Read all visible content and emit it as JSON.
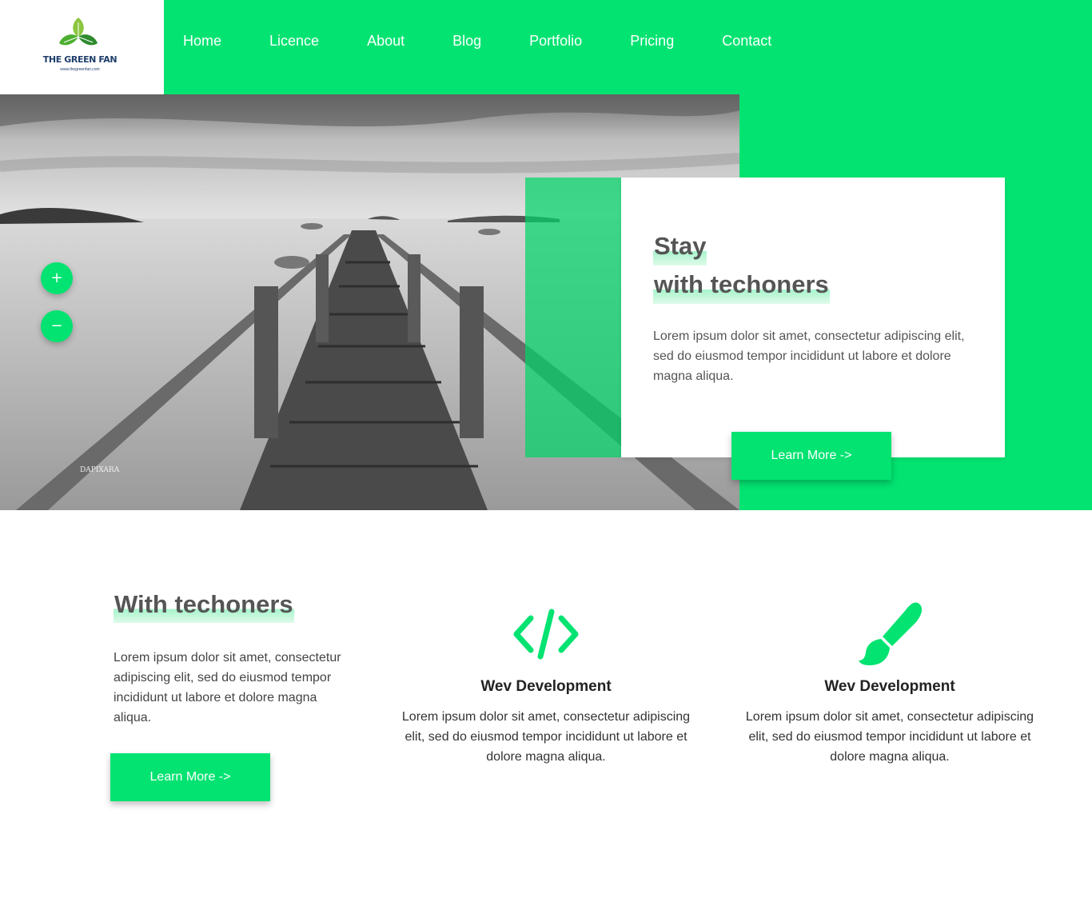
{
  "brand": {
    "name": "THE GREEN FAN",
    "url": "www.thegreenfan.com",
    "accent": "#02e371"
  },
  "nav": [
    "Home",
    "Licence",
    "About",
    "Blog",
    "Portfolio",
    "Pricing",
    "Contact"
  ],
  "hero": {
    "image": "black-and-white-pier-on-lake",
    "watermark": "DAPIXARA",
    "zoom_in": "+",
    "zoom_out": "−",
    "title_line1": "Stay",
    "title_line2": "with techoners",
    "text": "Lorem ipsum dolor sit amet, consectetur adipiscing elit, sed do eiusmod tempor incididunt ut labore et dolore magna aliqua.",
    "button": "Learn More ->"
  },
  "about": {
    "title": "With techoners",
    "text": "Lorem ipsum dolor sit amet, consectetur adipiscing elit, sed do eiusmod tempor incididunt ut labore et dolore magna aliqua.",
    "button": "Learn More ->"
  },
  "features": [
    {
      "icon": "code-icon",
      "title": "Wev Development",
      "text": "Lorem ipsum dolor sit amet, consectetur adipiscing elit, sed do eiusmod tempor incididunt ut labore et dolore magna aliqua."
    },
    {
      "icon": "paintbrush-icon",
      "title": "Wev Development",
      "text": "Lorem ipsum dolor sit amet, consectetur adipiscing elit, sed do eiusmod tempor incididunt ut labore et dolore magna aliqua."
    }
  ]
}
